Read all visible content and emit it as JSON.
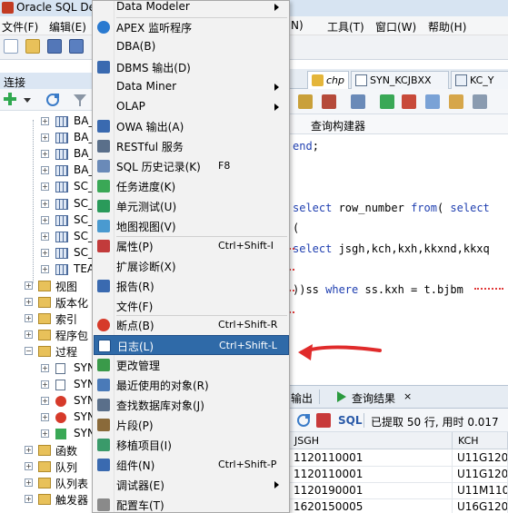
{
  "window": {
    "title": "Oracle SQL De"
  },
  "menubar": {
    "file": "文件(F)",
    "edit": "编辑(E)",
    "partial_n": "N)",
    "tools": "工具(T)",
    "window": "窗口(W)",
    "help": "帮助(H)"
  },
  "connections": {
    "title": "连接",
    "tree": [
      {
        "label": "BA_",
        "kind": "table"
      },
      {
        "label": "BA_",
        "kind": "table"
      },
      {
        "label": "BA_",
        "kind": "table"
      },
      {
        "label": "BA_",
        "kind": "table"
      },
      {
        "label": "SC_",
        "kind": "table"
      },
      {
        "label": "SC_",
        "kind": "table"
      },
      {
        "label": "SC_",
        "kind": "table"
      },
      {
        "label": "SC_",
        "kind": "table"
      },
      {
        "label": "SC_",
        "kind": "table"
      },
      {
        "label": "TEA",
        "kind": "table"
      },
      {
        "label": "视图",
        "kind": "folder"
      },
      {
        "label": "版本化",
        "kind": "folder"
      },
      {
        "label": "索引",
        "kind": "folder"
      },
      {
        "label": "程序包",
        "kind": "folder"
      },
      {
        "label": "过程",
        "kind": "folder-open"
      },
      {
        "label": "SYN",
        "kind": "proc"
      },
      {
        "label": "SYN",
        "kind": "proc"
      },
      {
        "label": "SYN",
        "kind": "proc-error"
      },
      {
        "label": "SYN",
        "kind": "proc-error"
      },
      {
        "label": "SYN",
        "kind": "proc-green"
      },
      {
        "label": "函数",
        "kind": "folder"
      },
      {
        "label": "队列",
        "kind": "folder"
      },
      {
        "label": "队列表",
        "kind": "folder"
      },
      {
        "label": "触发器",
        "kind": "folder"
      }
    ]
  },
  "editor": {
    "tabs": [
      {
        "label": "chp"
      },
      {
        "label": "SYN_KCJBXX"
      },
      {
        "label": "KC_Y"
      }
    ],
    "subtab": "查询构建器",
    "code": [
      {
        "kw": "end",
        "rest": ";"
      },
      {
        "kw": "",
        "rest": ""
      },
      {
        "kw": "",
        "rest": ""
      },
      {
        "kw": "select",
        "rest": " row_number ",
        "kw2": "from",
        "rest2": "( ",
        "kw3": "select"
      },
      {
        "kw": "",
        "rest": "("
      },
      {
        "kw": "select",
        "rest": " jsgh,kch,kxh,kkxnd,kkxq"
      },
      {
        "kw": "",
        "rest": ""
      },
      {
        "kw": "",
        "rest": "))ss ",
        "kw2": "where",
        "rest2": " ss.kxh = t.bjbm"
      }
    ]
  },
  "results": {
    "output_tab": "输出",
    "query_tab": "查询结果",
    "sql_label": "SQL",
    "status": "已提取 50 行, 用时 0.017",
    "columns": [
      "JSGH",
      "KCH"
    ],
    "rows": [
      [
        "1120110001",
        "U11G1203"
      ],
      [
        "1120110001",
        "U11G1203"
      ],
      [
        "1120190001",
        "U11M1102"
      ],
      [
        "1620150005",
        "U16G1201"
      ]
    ]
  },
  "view_menu": {
    "items": [
      {
        "label": "Data Modeler",
        "shortcut": "",
        "submenu": true,
        "icon": ""
      },
      {
        "label": "APEX 监听程序",
        "shortcut": "",
        "submenu": false,
        "icon": "apex-icon"
      },
      {
        "label": "DBA(B)",
        "shortcut": "",
        "submenu": false,
        "icon": ""
      },
      {
        "label": "DBMS 输出(D)",
        "shortcut": "",
        "submenu": false,
        "icon": "dbms-output-icon"
      },
      {
        "label": "Data Miner",
        "shortcut": "",
        "submenu": true,
        "icon": ""
      },
      {
        "label": "OLAP",
        "shortcut": "",
        "submenu": true,
        "icon": ""
      },
      {
        "label": "OWA 输出(A)",
        "shortcut": "",
        "submenu": false,
        "icon": "owa-icon"
      },
      {
        "label": "RESTful 服务",
        "shortcut": "",
        "submenu": false,
        "icon": "rest-icon"
      },
      {
        "label": "SQL 历史记录(K)",
        "shortcut": "F8",
        "submenu": false,
        "icon": "sql-history-icon"
      },
      {
        "label": "任务进度(K)",
        "shortcut": "",
        "submenu": false,
        "icon": "task-progress-icon"
      },
      {
        "label": "单元测试(U)",
        "shortcut": "",
        "submenu": false,
        "icon": "unit-test-icon"
      },
      {
        "label": "地图视图(V)",
        "shortcut": "",
        "submenu": false,
        "icon": "map-icon"
      },
      {
        "label": "属性(P)",
        "shortcut": "Ctrl+Shift-I",
        "submenu": false,
        "icon": "properties-icon"
      },
      {
        "label": "扩展诊断(X)",
        "shortcut": "",
        "submenu": false,
        "icon": ""
      },
      {
        "label": "报告(R)",
        "shortcut": "",
        "submenu": false,
        "icon": "report-icon"
      },
      {
        "label": "文件(F)",
        "shortcut": "",
        "submenu": false,
        "icon": ""
      },
      {
        "label": "断点(B)",
        "shortcut": "Ctrl+Shift-R",
        "submenu": false,
        "icon": "breakpoint-icon"
      },
      {
        "label": "日志(L)",
        "shortcut": "Ctrl+Shift-L",
        "submenu": false,
        "icon": "log-icon",
        "highlighted": true
      },
      {
        "label": "更改管理",
        "shortcut": "",
        "submenu": false,
        "icon": "change-mgmt-icon"
      },
      {
        "label": "最近使用的对象(R)",
        "shortcut": "",
        "submenu": false,
        "icon": "recent-objects-icon"
      },
      {
        "label": "查找数据库对象(J)",
        "shortcut": "",
        "submenu": false,
        "icon": "find-db-icon"
      },
      {
        "label": "片段(P)",
        "shortcut": "",
        "submenu": false,
        "icon": "snippets-icon"
      },
      {
        "label": "移植项目(I)",
        "shortcut": "",
        "submenu": false,
        "icon": "migration-icon"
      },
      {
        "label": "组件(N)",
        "shortcut": "Ctrl+Shift-P",
        "submenu": false,
        "icon": "components-icon"
      },
      {
        "label": "调试器(E)",
        "shortcut": "",
        "submenu": true,
        "icon": ""
      },
      {
        "label": "配置车(T)",
        "shortcut": "",
        "submenu": false,
        "icon": "cart-icon"
      }
    ]
  },
  "colors": {
    "menu_highlight": "#2f6aa8",
    "keyword": "#1f3fb0",
    "annotation_arrow": "#e02b2b"
  }
}
